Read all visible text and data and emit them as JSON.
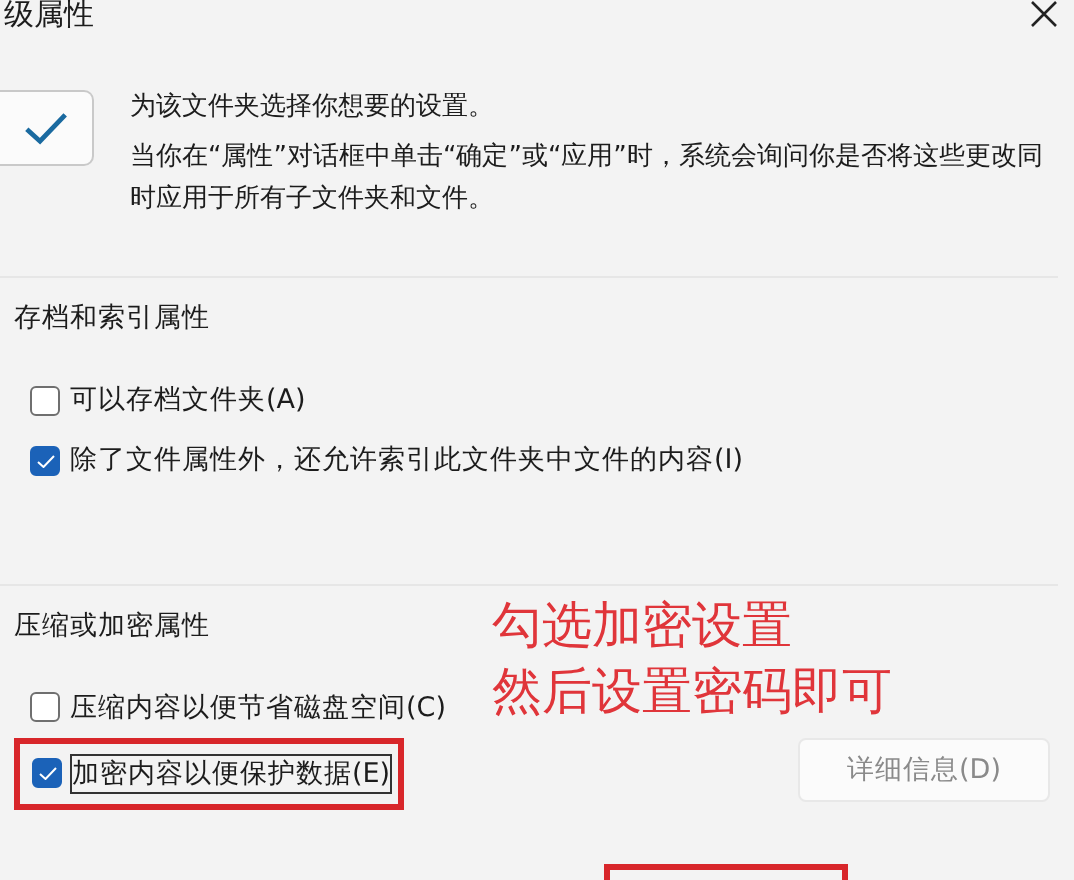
{
  "window": {
    "title": "级属性"
  },
  "intro": {
    "checked": true,
    "heading": "为该文件夹选择你想要的设置。",
    "text": "当你在“属性”对话框中单击“确定”或“应用”时，系统会询问你是否将这些更改同时应用于所有子文件夹和文件。"
  },
  "sections": [
    {
      "title": "存档和索引属性",
      "options": [
        {
          "label": "可以存档文件夹(A)",
          "checked": false,
          "highlighted": false
        },
        {
          "label": "除了文件属性外，还允许索引此文件夹中文件的内容(I)",
          "checked": true,
          "highlighted": false
        }
      ]
    },
    {
      "title": "压缩或加密属性",
      "options": [
        {
          "label": "压缩内容以便节省磁盘空间(C)",
          "checked": false,
          "highlighted": false
        },
        {
          "label": "加密内容以便保护数据(E)",
          "checked": true,
          "highlighted": true
        }
      ],
      "button": {
        "label": "详细信息(D)",
        "disabled": true
      }
    }
  ],
  "annotation": {
    "lines": [
      "勾选加密设置",
      "然后设置密码即可"
    ]
  }
}
